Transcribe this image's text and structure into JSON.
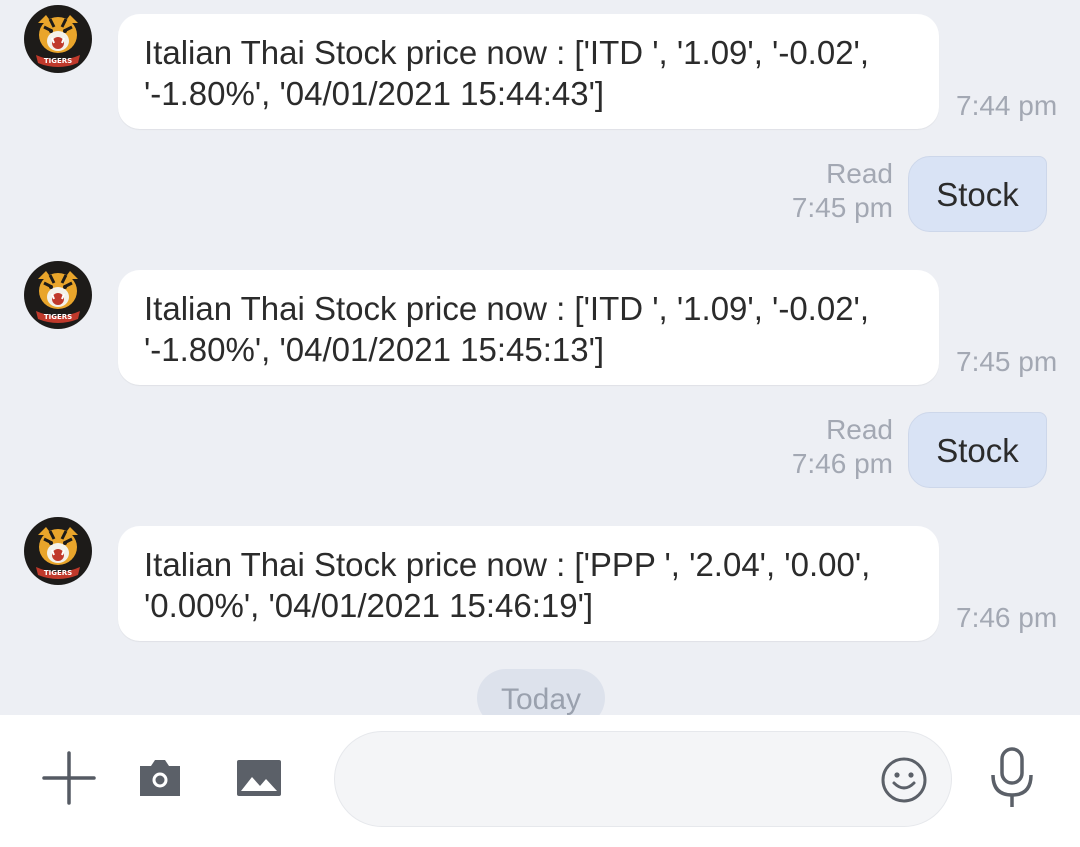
{
  "conversation": {
    "messages": [
      {
        "type": "incoming",
        "avatar": "tiger-logo",
        "avatar_text": "TIGERS",
        "line1": "Italian Thai Stock price now  : ['ITD ', '1.09', '-0.02',",
        "line2": "'-1.80%', '04/01/2021 15:44:43']",
        "time": "7:44 pm"
      },
      {
        "type": "outgoing",
        "status": "Read",
        "time": "7:45 pm",
        "text": "Stock"
      },
      {
        "type": "incoming",
        "avatar": "tiger-logo",
        "avatar_text": "TIGERS",
        "line1": "Italian Thai Stock price now  : ['ITD ', '1.09', '-0.02',",
        "line2": "'-1.80%', '04/01/2021 15:45:13']",
        "time": "7:45 pm"
      },
      {
        "type": "outgoing",
        "status": "Read",
        "time": "7:46 pm",
        "text": "Stock"
      },
      {
        "type": "incoming",
        "avatar": "tiger-logo",
        "avatar_text": "TIGERS",
        "line1": "Italian Thai Stock price now  : ['PPP ', '2.04', '0.00',",
        "line2": "'0.00%', '04/01/2021 15:46:19']",
        "time": "7:46 pm"
      }
    ],
    "date_separator": "Today"
  },
  "input_bar": {
    "message_value": "",
    "icons": [
      "plus-icon",
      "camera-icon",
      "image-icon",
      "emoji-icon",
      "microphone-icon"
    ]
  },
  "colors": {
    "background": "#edeff4",
    "incoming_bubble": "#ffffff",
    "outgoing_bubble": "#d9e3f5",
    "timestamp": "#a3a8b3"
  }
}
